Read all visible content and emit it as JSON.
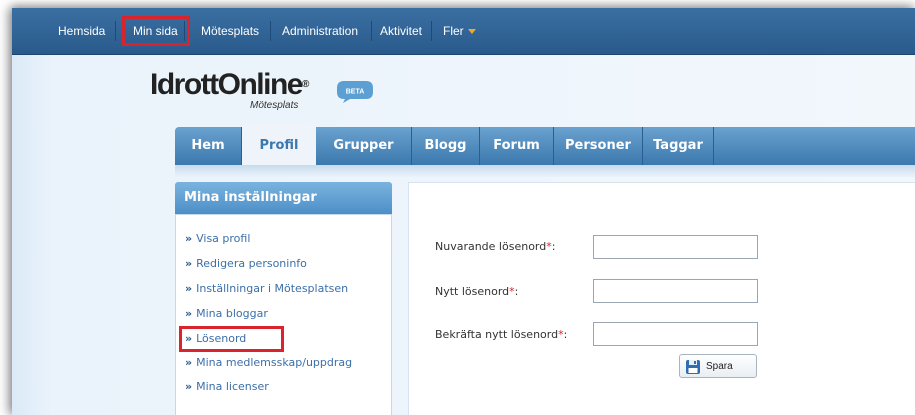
{
  "topnav": {
    "items": [
      {
        "label": "Hemsida"
      },
      {
        "label": "Min sida"
      },
      {
        "label": "Mötesplats"
      },
      {
        "label": "Administration"
      },
      {
        "label": "Aktivitet"
      },
      {
        "label": "Fler"
      }
    ],
    "highlighted": "Min sida"
  },
  "logo": {
    "name": "IdrottOnline",
    "registered": "®",
    "subtitle": "Mötesplats",
    "badge": "BETA"
  },
  "tabs": {
    "items": [
      {
        "label": "Hem"
      },
      {
        "label": "Profil"
      },
      {
        "label": "Grupper"
      },
      {
        "label": "Blogg"
      },
      {
        "label": "Forum"
      },
      {
        "label": "Personer"
      },
      {
        "label": "Taggar"
      }
    ],
    "active": "Profil"
  },
  "sidebar": {
    "title": "Mina inställningar",
    "arrow": "»",
    "links": [
      {
        "label": "Visa profil"
      },
      {
        "label": "Redigera personinfo"
      },
      {
        "label": "Inställningar i Mötesplatsen"
      },
      {
        "label": "Mina bloggar"
      },
      {
        "label": "Lösenord"
      },
      {
        "label": "Mina medlemsskap/uppdrag"
      },
      {
        "label": "Mina licenser"
      }
    ],
    "highlighted": "Lösenord"
  },
  "form": {
    "required_marker": "*",
    "fields": [
      {
        "label": "Nuvarande lösenord",
        "suffix": ":",
        "value": ""
      },
      {
        "label": "Nytt lösenord",
        "suffix": ":",
        "value": ""
      },
      {
        "label": "Bekräfta nytt lösenord",
        "suffix": ":",
        "value": ""
      }
    ],
    "save_label": "Spara"
  },
  "colors": {
    "topbar": "#2a5a8c",
    "highlight": "#d9232d",
    "tab_bar": "#3b78ad",
    "link": "#3b6fa8"
  }
}
